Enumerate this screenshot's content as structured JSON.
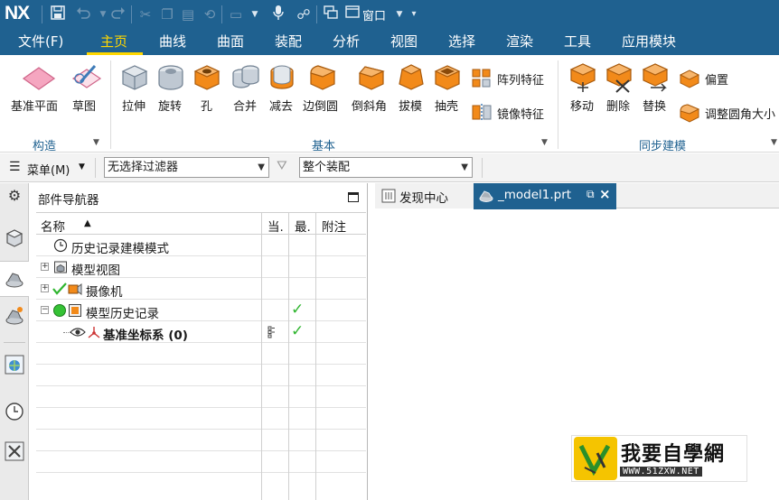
{
  "quick_access": {
    "logo": "NX",
    "window_menu_label": "窗口",
    "icons": [
      "save-icon",
      "undo-icon",
      "redo-icon",
      "cut-icon",
      "copy-icon",
      "paste-icon",
      "repeat-command-icon",
      "touch-mode-icon",
      "microphone-icon",
      "customize-icon",
      "window-switch-icon"
    ]
  },
  "menu": {
    "items": [
      {
        "label": "文件(F)",
        "active": false
      },
      {
        "label": "主页",
        "active": true
      },
      {
        "label": "曲线",
        "active": false
      },
      {
        "label": "曲面",
        "active": false
      },
      {
        "label": "装配",
        "active": false
      },
      {
        "label": "分析",
        "active": false
      },
      {
        "label": "视图",
        "active": false
      },
      {
        "label": "选择",
        "active": false
      },
      {
        "label": "渲染",
        "active": false
      },
      {
        "label": "工具",
        "active": false
      },
      {
        "label": "应用模块",
        "active": false
      }
    ]
  },
  "ribbon": {
    "groups": {
      "construct": "构造",
      "basic": "基本",
      "sync": "同步建模"
    },
    "buttons": {
      "datum_plane": "基准平面",
      "sketch": "草图",
      "extrude": "拉伸",
      "revolve": "旋转",
      "hole": "孔",
      "unite": "合并",
      "subtract": "减去",
      "edge_blend": "边倒圆",
      "chamfer": "倒斜角",
      "draft": "拔模",
      "shell": "抽壳",
      "pattern_feature": "阵列特征",
      "mirror_feature": "镜像特征",
      "move": "移动",
      "delete": "删除",
      "replace": "替换",
      "offset": "偏置",
      "resize_blend": "调整圆角大小"
    }
  },
  "filterbar": {
    "menu_label": "菜单(M)",
    "type_filter": "无选择过滤器",
    "scope": "整个装配"
  },
  "navigator": {
    "title": "部件导航器",
    "columns": {
      "name": "名称",
      "current": "当.",
      "latest": "最.",
      "notes": "附注"
    },
    "rows": [
      {
        "label": "历史记录建模模式",
        "current": "",
        "latest": ""
      },
      {
        "label": "模型视图",
        "current": "",
        "latest": ""
      },
      {
        "label": "摄像机",
        "current": "",
        "latest": ""
      },
      {
        "label": "模型历史记录",
        "current": "",
        "latest": "✓"
      },
      {
        "label": "基准坐标系 (0)",
        "current": "",
        "latest": "✓"
      }
    ]
  },
  "tabs": {
    "discovery": "发现中心",
    "model": "_model1.prt"
  },
  "watermark": {
    "title": "我要自學網",
    "url": "WWW.51ZXW.NET"
  },
  "colors": {
    "titlebar": "#1f6190",
    "active_tab": "#ffd700",
    "feature_orange": "#f28a1a",
    "group_label": "#1f6190",
    "check_green": "#2fb52f"
  }
}
